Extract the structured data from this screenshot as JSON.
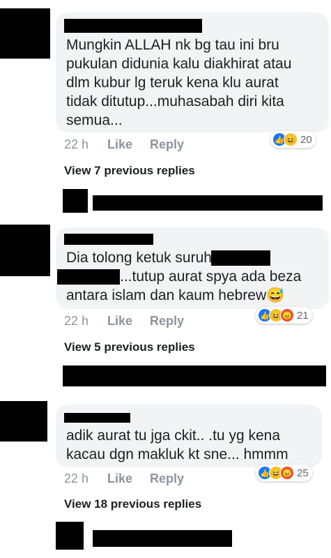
{
  "comments": [
    {
      "text": [
        "Mungkin ALLAH nk bg tau ini bru",
        "pukulan didunia kalu diakhirat atau",
        "dlm kubur lg teruk kena klu aurat",
        "tidak ditutup...muhasabah diri kita",
        "semua..."
      ],
      "time": "22 h",
      "like": "Like",
      "reply": "Reply",
      "reaction_count": "20",
      "reaction_icons": [
        "like-icon",
        "haha-icon"
      ],
      "view_replies": "View 7 previous replies"
    },
    {
      "line1": "Dia tolong ketuk suruh",
      "line2": "...tutup aurat spya ada beza",
      "line3": "antara islam dan kaum hebrew😅",
      "time": "22 h",
      "like": "Like",
      "reply": "Reply",
      "reaction_count": "21",
      "reaction_icons": [
        "like-icon",
        "haha-icon",
        "angry-icon"
      ],
      "view_replies": "View 5 previous replies"
    },
    {
      "text": [
        "adik aurat tu jga ckit.. .tu yg kena",
        "kacau dgn makluk kt sne... hmmm"
      ],
      "time": "22 h",
      "like": "Like",
      "reply": "Reply",
      "reaction_count": "25",
      "reaction_icons": [
        "like-icon",
        "haha-icon",
        "angry-icon"
      ],
      "view_replies": "View 18 previous replies"
    }
  ]
}
